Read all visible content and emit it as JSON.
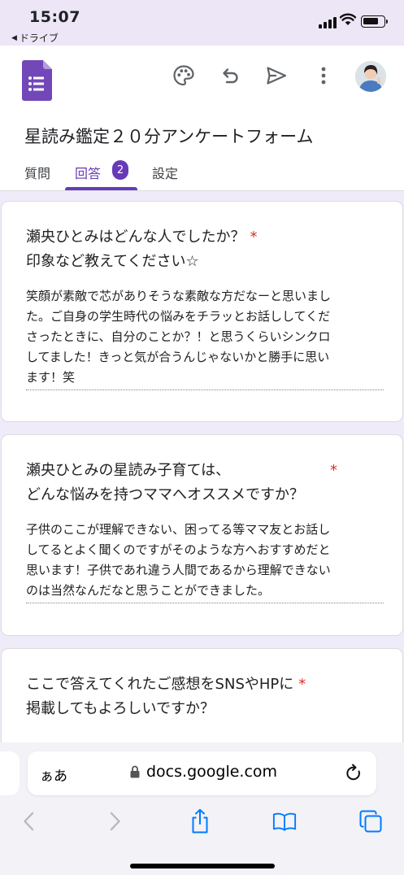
{
  "status": {
    "time": "15:07",
    "back_app": "ドライブ"
  },
  "header": {
    "form_title": "星読み鑑定２０分アンケートフォーム"
  },
  "tabs": [
    {
      "label": "質問"
    },
    {
      "label": "回答",
      "badge": "2",
      "active": true
    },
    {
      "label": "設定"
    }
  ],
  "questions": [
    {
      "title_lines": [
        "瀬央ひとみはどんな人でしたか？",
        "印象など教えてください☆"
      ],
      "required_mark": "*",
      "answer_lines": [
        "笑顔が素敵で芯がありそうな素敵な方だなーと思いまし",
        "た。ご自身の学生時代の悩みをチラッとお話ししてくだ",
        "さったときに、自分のことか？！と思うくらいシンクロ",
        "してました！きっと気が合うんじゃないかと勝手に思い",
        "ます！笑"
      ]
    },
    {
      "title_lines": [
        "瀬央ひとみの星読み子育ては、",
        "どんな悩みを持つママへオススメですか？"
      ],
      "required_mark": "*",
      "answer_lines": [
        "子供のここが理解できない、困ってる等ママ友とお話し",
        "してるとよく聞くのですがそのような方へおすすめだと",
        "思います！子供であれ違う人間であるから理解できない",
        "のは当然なんだなと思うことができました。"
      ]
    },
    {
      "title_lines": [
        "ここで答えてくれたご感想をSNSやHPに",
        "掲載してもよろしいですか？"
      ],
      "required_mark": "*"
    }
  ],
  "browser": {
    "text_size_label": "ぁあ",
    "url": "docs.google.com"
  },
  "icons": {
    "forms_logo": "google-forms-icon",
    "palette": "palette-icon",
    "undo": "undo-icon",
    "send": "send-icon",
    "more": "more-vert-icon",
    "share": "share-icon",
    "bookmarks": "book-icon",
    "tabs": "tabs-icon"
  },
  "colors": {
    "accent": "#673ab7",
    "background": "#f0ebf8",
    "required": "#d93025",
    "safari_blue": "#007aff"
  }
}
